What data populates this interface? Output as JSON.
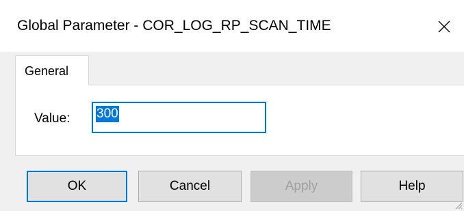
{
  "window": {
    "title": "Global Parameter - COR_LOG_RP_SCAN_TIME"
  },
  "tabs": [
    {
      "label": "General",
      "selected": true
    }
  ],
  "form": {
    "value_label": "Value:",
    "value": "300"
  },
  "buttons": {
    "ok": "OK",
    "cancel": "Cancel",
    "apply": "Apply",
    "help": "Help"
  },
  "icons": {
    "close": "close-icon",
    "resize": "resize-grip-icon"
  },
  "colors": {
    "accent": "#0078d7",
    "panel_bg": "#f0f0f0",
    "button_bg": "#e1e1e1"
  }
}
